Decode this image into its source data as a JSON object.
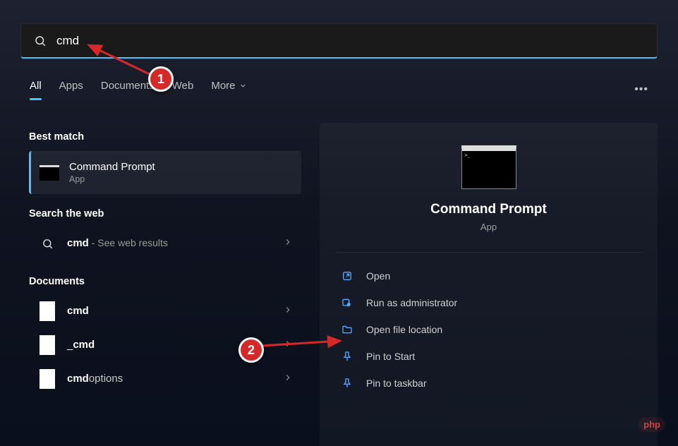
{
  "search": {
    "query": "cmd"
  },
  "tabs": {
    "all": "All",
    "apps": "Apps",
    "documents": "Documents",
    "web": "Web",
    "more": "More"
  },
  "sections": {
    "best_match": "Best match",
    "search_web": "Search the web",
    "documents": "Documents"
  },
  "best": {
    "title": "Command Prompt",
    "subtitle": "App"
  },
  "web": {
    "query_bold": "cmd",
    "suffix": " - See web results"
  },
  "docs": {
    "0": {
      "name": "cmd"
    },
    "1": {
      "prefix": "_",
      "name": "cmd"
    },
    "2": {
      "name": "cmd",
      "suffix": "options"
    }
  },
  "preview": {
    "title": "Command Prompt",
    "subtitle": "App"
  },
  "actions": {
    "open": "Open",
    "run_admin": "Run as administrator",
    "open_location": "Open file location",
    "pin_start": "Pin to Start",
    "pin_taskbar": "Pin to taskbar"
  },
  "watermark": "php"
}
